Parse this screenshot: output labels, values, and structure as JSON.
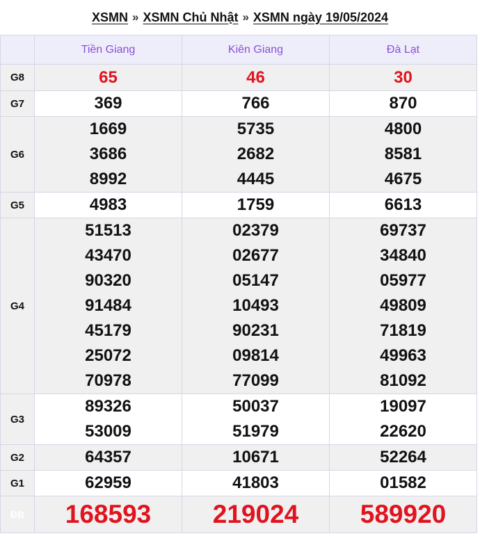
{
  "breadcrumb": {
    "items": [
      "XSMN",
      "XSMN Chủ Nhật",
      "XSMN ngày 19/05/2024"
    ],
    "separator": "»"
  },
  "table": {
    "provinces": [
      "Tiền Giang",
      "Kiên Giang",
      "Đà Lạt"
    ],
    "prizes": {
      "G8": {
        "label": "G8",
        "values": [
          "65",
          "46",
          "30"
        ]
      },
      "G7": {
        "label": "G7",
        "values": [
          "369",
          "766",
          "870"
        ]
      },
      "G6": {
        "label": "G6",
        "values": [
          [
            "1669",
            "3686",
            "8992"
          ],
          [
            "5735",
            "2682",
            "4445"
          ],
          [
            "4800",
            "8581",
            "4675"
          ]
        ]
      },
      "G5": {
        "label": "G5",
        "values": [
          "4983",
          "1759",
          "6613"
        ]
      },
      "G4": {
        "label": "G4",
        "values": [
          [
            "51513",
            "43470",
            "90320",
            "91484",
            "45179",
            "25072",
            "70978"
          ],
          [
            "02379",
            "02677",
            "05147",
            "10493",
            "90231",
            "09814",
            "77099"
          ],
          [
            "69737",
            "34840",
            "05977",
            "49809",
            "71819",
            "49963",
            "81092"
          ]
        ]
      },
      "G3": {
        "label": "G3",
        "values": [
          [
            "89326",
            "53009"
          ],
          [
            "50037",
            "51979"
          ],
          [
            "19097",
            "22620"
          ]
        ]
      },
      "G2": {
        "label": "G2",
        "values": [
          "64357",
          "10671",
          "52264"
        ]
      },
      "G1": {
        "label": "G1",
        "values": [
          "62959",
          "41803",
          "01582"
        ]
      },
      "DB": {
        "label": "ĐB",
        "values": [
          "168593",
          "219024",
          "589920"
        ]
      }
    },
    "colors": {
      "header_text": "#8a4fd9",
      "special_red": "#e0141e",
      "db_label_bg": "#e6231e"
    }
  }
}
